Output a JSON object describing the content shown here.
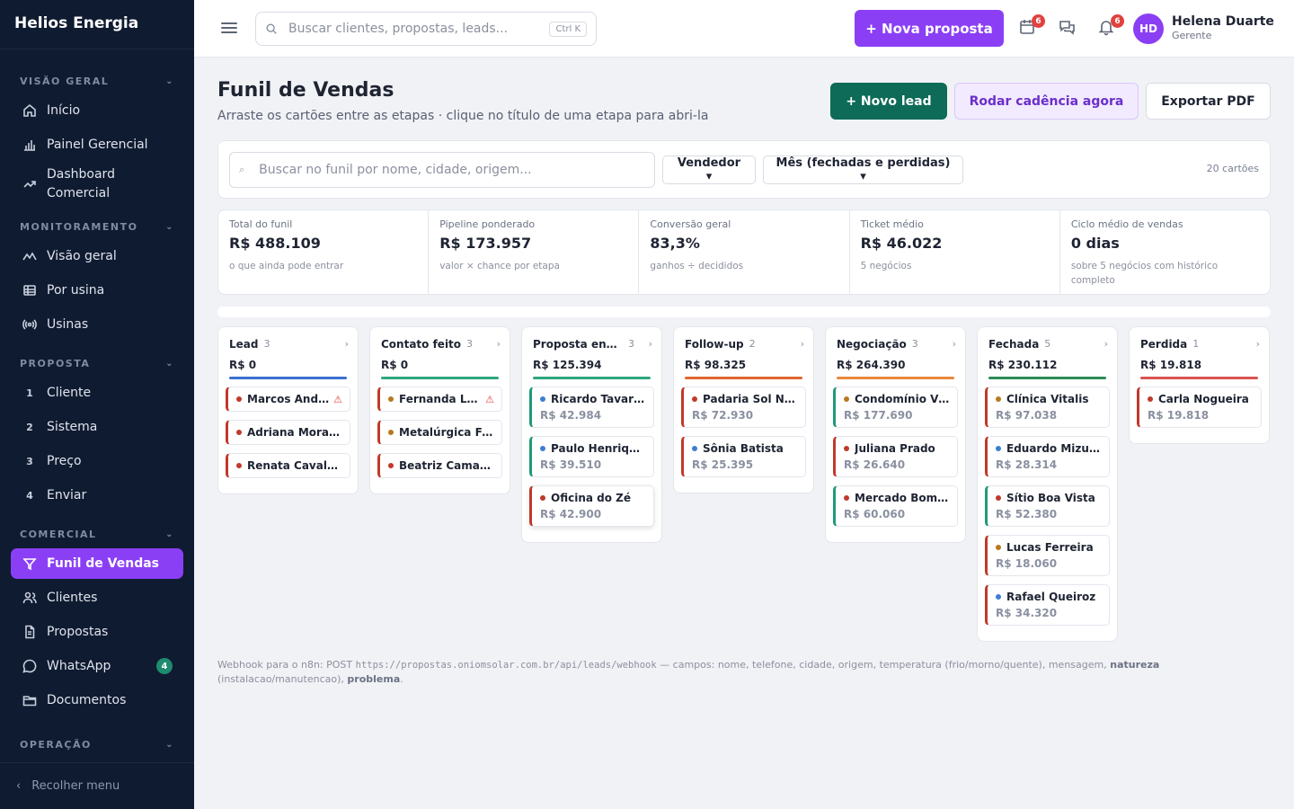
{
  "brand": "Helios Energia",
  "sidebar": {
    "sections": [
      {
        "title": "VISÃO GERAL",
        "items": [
          {
            "label": "Início",
            "icon": "home-icon"
          },
          {
            "label": "Painel Gerencial",
            "icon": "bar-chart-icon"
          },
          {
            "label": "Dashboard Comercial",
            "icon": "trend-icon"
          }
        ]
      },
      {
        "title": "MONITORAMENTO",
        "items": [
          {
            "label": "Visão geral",
            "icon": "pulse-icon"
          },
          {
            "label": "Por usina",
            "icon": "table-icon"
          },
          {
            "label": "Usinas",
            "icon": "broadcast-icon"
          }
        ]
      },
      {
        "title": "PROPOSTA",
        "items": [
          {
            "num": "1",
            "label": "Cliente"
          },
          {
            "num": "2",
            "label": "Sistema"
          },
          {
            "num": "3",
            "label": "Preço"
          },
          {
            "num": "4",
            "label": "Enviar"
          }
        ]
      },
      {
        "title": "COMERCIAL",
        "items": [
          {
            "label": "Funil de Vendas",
            "icon": "funnel-icon"
          },
          {
            "label": "Clientes",
            "icon": "users-icon"
          },
          {
            "label": "Propostas",
            "icon": "document-icon"
          },
          {
            "label": "WhatsApp",
            "icon": "whatsapp-icon",
            "badge": "4"
          },
          {
            "label": "Documentos",
            "icon": "folder-icon"
          }
        ]
      },
      {
        "title": "OPERAÇÃO",
        "items": []
      }
    ],
    "collapse_label": "Recolher menu"
  },
  "topbar": {
    "search_placeholder": "Buscar clientes, propostas, leads...",
    "shortcut": "Ctrl K",
    "new_proposal": "+ Nova proposta",
    "calendar_badge": "6",
    "bell_badge": "6",
    "user_initials": "HD",
    "user_name": "Helena Duarte",
    "user_role": "Gerente"
  },
  "page": {
    "title": "Funil de Vendas",
    "subtitle": "Arraste os cartões entre as etapas · clique no título de uma etapa para abri-la",
    "btn_new_lead": "+ Novo lead",
    "btn_cadence": "Rodar cadência agora",
    "btn_pdf": "Exportar PDF"
  },
  "filters": {
    "search_placeholder": "Buscar no funil por nome, cidade, origem...",
    "seller": "Vendedor ▾",
    "period": "Mês (fechadas e perdidas) ▾",
    "count": "20 cartões"
  },
  "stats": [
    {
      "label": "Total do funil",
      "value": "R$ 488.109",
      "hint": "o que ainda pode entrar"
    },
    {
      "label": "Pipeline ponderado",
      "value": "R$ 173.957",
      "hint": "valor × chance por etapa"
    },
    {
      "label": "Conversão geral",
      "value": "83,3%",
      "hint": "ganhos ÷ decididos"
    },
    {
      "label": "Ticket médio",
      "value": "R$ 46.022",
      "hint": "5 negócios"
    },
    {
      "label": "Ciclo médio de vendas",
      "value": "0 dias",
      "hint": "sobre 5 negócios com histórico completo"
    }
  ],
  "columns": [
    {
      "name": "Lead",
      "count": "3",
      "total": "R$ 0",
      "color": "#3c6fd1",
      "cards": [
        {
          "name": "Marcos Andr...",
          "value": "",
          "dot": "#c0392b",
          "border": "#c0392b",
          "warn": true
        },
        {
          "name": "Adriana Moraes",
          "value": "",
          "dot": "#c0392b",
          "border": "#c0392b",
          "warn": false
        },
        {
          "name": "Renata Cavalca...",
          "value": "",
          "dot": "#c0392b",
          "border": "#c0392b",
          "warn": false
        }
      ]
    },
    {
      "name": "Contato feito",
      "count": "3",
      "total": "R$ 0",
      "color": "#2fa57f",
      "cards": [
        {
          "name": "Fernanda Lo...",
          "value": "",
          "dot": "#b7791f",
          "border": "#c0392b",
          "warn": true
        },
        {
          "name": "Metalúrgica Fe...",
          "value": "",
          "dot": "#b7791f",
          "border": "#c0392b",
          "warn": false
        },
        {
          "name": "Beatriz Camargo",
          "value": "",
          "dot": "#c0392b",
          "border": "#c0392b",
          "warn": false
        }
      ]
    },
    {
      "name": "Proposta envi...",
      "count": "3",
      "total": "R$ 125.394",
      "color": "#2fa57f",
      "cards": [
        {
          "name": "Ricardo Tavares",
          "value": "R$ 42.984",
          "dot": "#3c7fd1",
          "border": "#1f9a78",
          "warn": false
        },
        {
          "name": "Paulo Henrique...",
          "value": "R$ 39.510",
          "dot": "#3c7fd1",
          "border": "#1f9a78",
          "warn": false
        },
        {
          "name": "Oficina do Zé",
          "value": "R$ 42.900",
          "dot": "#c0392b",
          "border": "#c0392b",
          "warn": false
        }
      ]
    },
    {
      "name": "Follow-up",
      "count": "2",
      "total": "R$ 98.325",
      "color": "#e0652f",
      "cards": [
        {
          "name": "Padaria Sol Na...",
          "value": "R$ 72.930",
          "dot": "#c0392b",
          "border": "#c0392b",
          "warn": false
        },
        {
          "name": "Sônia Batista",
          "value": "R$ 25.395",
          "dot": "#3c7fd1",
          "border": "#c0392b",
          "warn": false
        }
      ]
    },
    {
      "name": "Negociação",
      "count": "3",
      "total": "R$ 264.390",
      "color": "#e8893a",
      "cards": [
        {
          "name": "Condomínio Vil...",
          "value": "R$ 177.690",
          "dot": "#b7791f",
          "border": "#1f9a78",
          "warn": false
        },
        {
          "name": "Juliana Prado",
          "value": "R$ 26.640",
          "dot": "#c0392b",
          "border": "#c0392b",
          "warn": false
        },
        {
          "name": "Mercado Bom ...",
          "value": "R$ 60.060",
          "dot": "#c0392b",
          "border": "#1f9a78",
          "warn": false
        }
      ]
    },
    {
      "name": "Fechada",
      "count": "5",
      "total": "R$ 230.112",
      "color": "#2e8b57",
      "cards": [
        {
          "name": "Clínica Vitalis",
          "value": "R$ 97.038",
          "dot": "#b7791f",
          "border": "#c0392b",
          "warn": false
        },
        {
          "name": "Eduardo Mizuno",
          "value": "R$ 28.314",
          "dot": "#3c7fd1",
          "border": "#c0392b",
          "warn": false
        },
        {
          "name": "Sítio Boa Vista",
          "value": "R$ 52.380",
          "dot": "#c0392b",
          "border": "#1f9a78",
          "warn": false
        },
        {
          "name": "Lucas Ferreira",
          "value": "R$ 18.060",
          "dot": "#b7791f",
          "border": "#c0392b",
          "warn": false
        },
        {
          "name": "Rafael Queiroz",
          "value": "R$ 34.320",
          "dot": "#3c7fd1",
          "border": "#c0392b",
          "warn": false
        }
      ]
    },
    {
      "name": "Perdida",
      "count": "1",
      "total": "R$ 19.818",
      "color": "#d9534f",
      "cards": [
        {
          "name": "Carla Nogueira",
          "value": "R$ 19.818",
          "dot": "#c0392b",
          "border": "#c0392b",
          "warn": false
        }
      ]
    }
  ],
  "footer": {
    "prefix": "Webhook para o n8n: POST ",
    "url": "https://propostas.oniomsolar.com.br/api/leads/webhook",
    "middle": " — campos: nome, telefone, cidade, origem, temperatura (frio/morno/quente), mensagem, ",
    "natureza": "natureza",
    "middle2": " (instalacao/manutencao), ",
    "problema": "problema",
    "end": "."
  }
}
